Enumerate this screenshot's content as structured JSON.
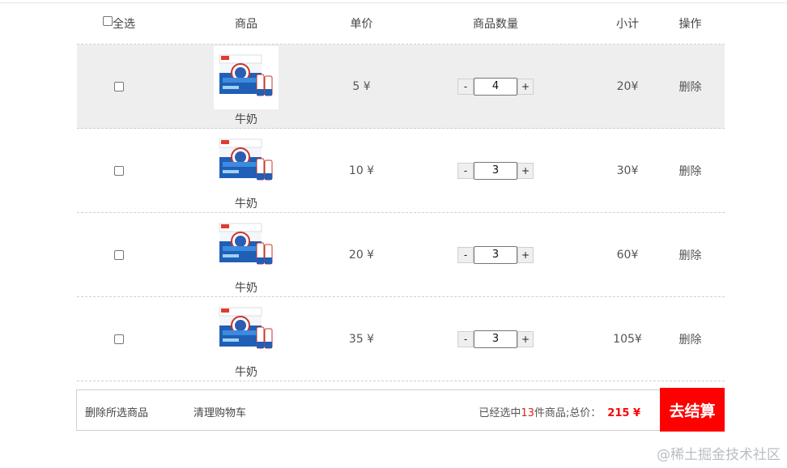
{
  "header": {
    "select_all": "全选",
    "product": "商品",
    "unit_price": "单价",
    "quantity": "商品数量",
    "subtotal": "小计",
    "operation": "操作"
  },
  "items": [
    {
      "name": "牛奶",
      "price": "5 ¥",
      "qty_minus": "-",
      "qty": "4",
      "qty_plus": "+",
      "subtotal": "20¥",
      "delete": "删除"
    },
    {
      "name": "牛奶",
      "price": "10 ¥",
      "qty_minus": "-",
      "qty": "3",
      "qty_plus": "+",
      "subtotal": "30¥",
      "delete": "删除"
    },
    {
      "name": "牛奶",
      "price": "20 ¥",
      "qty_minus": "-",
      "qty": "3",
      "qty_plus": "+",
      "subtotal": "60¥",
      "delete": "删除"
    },
    {
      "name": "牛奶",
      "price": "35 ¥",
      "qty_minus": "-",
      "qty": "3",
      "qty_plus": "+",
      "subtotal": "105¥",
      "delete": "删除"
    }
  ],
  "footer": {
    "delete_selected": "删除所选商品",
    "clear_cart": "清理购物车",
    "selected_prefix": "已经选中",
    "selected_count": "13",
    "selected_suffix": "件商品;总价：",
    "total": "215 ¥",
    "checkout": "去结算"
  },
  "watermark": "@稀土掘金技术社区",
  "colors": {
    "checkout_bg": "#ff0000",
    "highlight_row": "#eeeeee",
    "count_color": "#e0241b"
  }
}
